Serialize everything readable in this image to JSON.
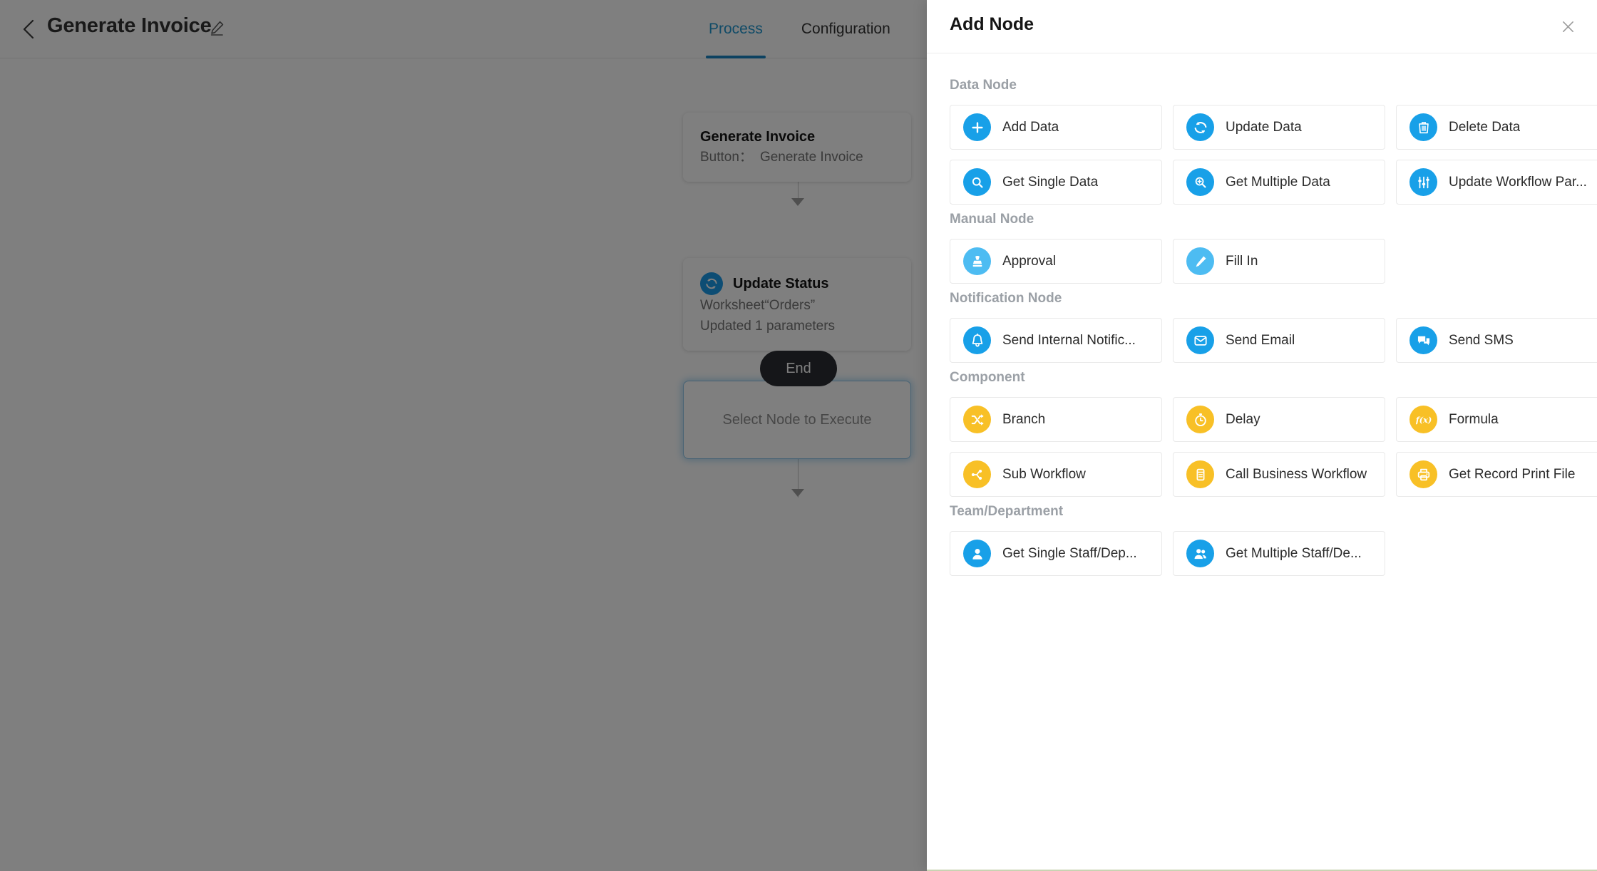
{
  "header": {
    "back_icon": "chevron-left-icon",
    "title": "Generate Invoice",
    "edit_icon": "pencil-edit-icon",
    "tabs": [
      {
        "label": "Process",
        "active": true
      },
      {
        "label": "Configuration",
        "active": false
      }
    ]
  },
  "canvas": {
    "start_node": {
      "title": "Generate Invoice",
      "sub_label": "Button：",
      "sub_value": "Generate Invoice"
    },
    "update_node": {
      "icon": "sync-refresh-icon",
      "title": "Update Status",
      "line1": "Worksheet“Orders”",
      "line2": "Updated 1 parameters"
    },
    "placeholder_node": {
      "label": "Select Node to Execute"
    },
    "end_node": {
      "label": "End"
    },
    "add_button_icon": "plus-icon"
  },
  "drawer": {
    "title": "Add Node",
    "close_icon": "close-icon",
    "sections": [
      {
        "title": "Data Node",
        "options": [
          {
            "label": "Add Data",
            "icon": "plus-icon",
            "color": "#18a0e8"
          },
          {
            "label": "Update Data",
            "icon": "sync-refresh-icon",
            "color": "#18a0e8"
          },
          {
            "label": "Delete Data",
            "icon": "trash-icon",
            "color": "#18a0e8"
          },
          {
            "label": "Get Single Data",
            "icon": "search-icon",
            "color": "#18a0e8"
          },
          {
            "label": "Get Multiple Data",
            "icon": "search-plus-icon",
            "color": "#18a0e8"
          },
          {
            "label": "Update Workflow Par...",
            "icon": "sliders-icon",
            "color": "#18a0e8"
          }
        ]
      },
      {
        "title": "Manual Node",
        "options": [
          {
            "label": "Approval",
            "icon": "stamp-icon",
            "color": "#4dbcf2"
          },
          {
            "label": "Fill In",
            "icon": "pen-icon",
            "color": "#4dbcf2"
          }
        ]
      },
      {
        "title": "Notification Node",
        "options": [
          {
            "label": "Send Internal Notific...",
            "icon": "bell-icon",
            "color": "#18a0e8"
          },
          {
            "label": "Send Email",
            "icon": "envelope-icon",
            "color": "#18a0e8"
          },
          {
            "label": "Send SMS",
            "icon": "chat-bubbles-icon",
            "color": "#18a0e8"
          }
        ]
      },
      {
        "title": "Component",
        "options": [
          {
            "label": "Branch",
            "icon": "shuffle-icon",
            "color": "#f8c026"
          },
          {
            "label": "Delay",
            "icon": "stopwatch-icon",
            "color": "#f8c026"
          },
          {
            "label": "Formula",
            "icon": "function-fx-icon",
            "color": "#f8c026"
          },
          {
            "label": "Sub Workflow",
            "icon": "branch-node-icon",
            "color": "#f8c026"
          },
          {
            "label": "Call Business Workflow",
            "icon": "container-icon",
            "color": "#f8c026"
          },
          {
            "label": "Get Record Print File",
            "icon": "printer-icon",
            "color": "#f8c026"
          }
        ]
      },
      {
        "title": "Team/Department",
        "options": [
          {
            "label": "Get Single Staff/Dep...",
            "icon": "user-single-icon",
            "color": "#18a0e8"
          },
          {
            "label": "Get Multiple Staff/De...",
            "icon": "user-multiple-icon",
            "color": "#18a0e8"
          }
        ]
      }
    ]
  },
  "colors": {
    "accent_blue": "#18a0e8",
    "light_blue": "#4dbcf2",
    "amber": "#f8c026",
    "tab_active": "#2196cf",
    "end_node": "#2a2d33"
  }
}
